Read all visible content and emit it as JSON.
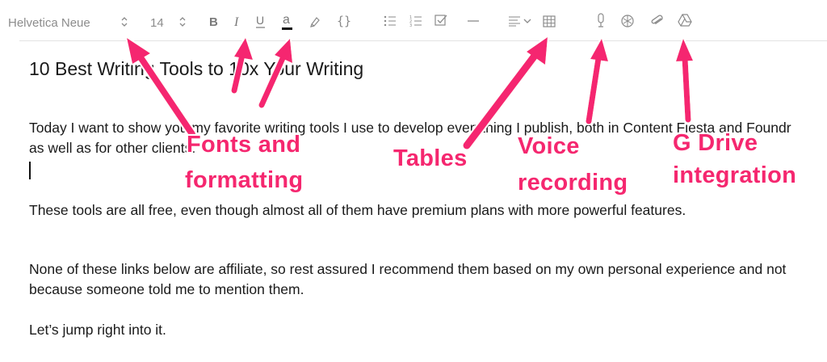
{
  "toolbar": {
    "font_family": "Helvetica Neue",
    "font_size": "14",
    "buttons": [
      {
        "name": "font-family-stepper",
        "icon": "up-down-chevron-icon"
      },
      {
        "name": "font-size-stepper",
        "icon": "up-down-chevron-icon"
      },
      {
        "name": "bold-button",
        "icon": "bold-icon"
      },
      {
        "name": "italic-button",
        "icon": "italic-icon"
      },
      {
        "name": "underline-button",
        "icon": "underline-icon"
      },
      {
        "name": "text-color-button",
        "icon": "text-color-icon"
      },
      {
        "name": "highlight-button",
        "icon": "highlighter-icon"
      },
      {
        "name": "code-button",
        "icon": "braces-icon"
      },
      {
        "name": "bullet-list-button",
        "icon": "bullet-list-icon"
      },
      {
        "name": "numbered-list-button",
        "icon": "numbered-list-icon"
      },
      {
        "name": "checklist-button",
        "icon": "checkbox-icon"
      },
      {
        "name": "horizontal-rule-button",
        "icon": "horizontal-rule-icon"
      },
      {
        "name": "align-dropdown",
        "icon": "align-left-icon"
      },
      {
        "name": "table-button",
        "icon": "table-icon"
      },
      {
        "name": "voice-record-button",
        "icon": "microphone-icon"
      },
      {
        "name": "dropbox-button",
        "icon": "dropbox-icon"
      },
      {
        "name": "attachment-button",
        "icon": "paperclip-icon"
      },
      {
        "name": "google-drive-button",
        "icon": "google-drive-icon"
      }
    ],
    "icon_color": "#8a8a8a",
    "text_color_underline": "#111111"
  },
  "document": {
    "title": "10 Best Writing Tools to 10x Your Writing",
    "paragraphs": [
      "Today I want to show you my favorite writing tools I use to develop everything I publish, both in Content Fiesta and Foundr as well as for other clients.",
      "These tools are all free, even though almost all of them have premium plans with more powerful features.",
      "None of these links below are affiliate, so rest assured I recommend them based on my own personal experience and not because someone told me to mention them.",
      "Let’s jump right into it."
    ]
  },
  "annotations": {
    "color": "#f5276f",
    "fonts": [
      "Fonts and",
      "formatting"
    ],
    "tables": "Tables",
    "voice": [
      "Voice",
      "recording"
    ],
    "drive": [
      "G Drive",
      "integration"
    ]
  }
}
